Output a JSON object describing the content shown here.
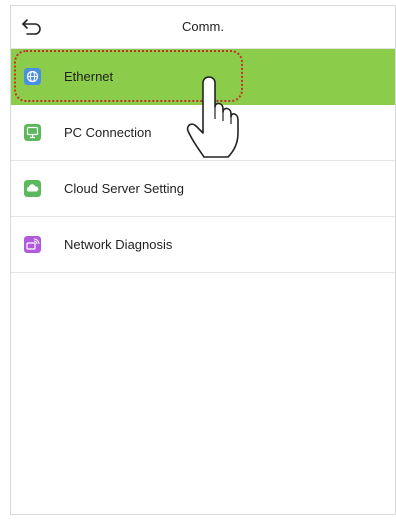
{
  "header": {
    "title": "Comm.",
    "back_icon": "back-arrow-icon"
  },
  "menu": {
    "items": [
      {
        "label": "Ethernet",
        "icon": "globe-icon",
        "color": "#4a90e2",
        "selected": true
      },
      {
        "label": "PC Connection",
        "icon": "monitor-icon",
        "color": "#5cb85c",
        "selected": false
      },
      {
        "label": "Cloud Server Setting",
        "icon": "cloud-icon",
        "color": "#5cb85c",
        "selected": false
      },
      {
        "label": "Network Diagnosis",
        "icon": "network-diagnosis-icon",
        "color": "#b05ae0",
        "selected": false
      }
    ]
  },
  "colors": {
    "selected_row": "#8ccc4b",
    "highlight_ring": "#c0312b"
  }
}
